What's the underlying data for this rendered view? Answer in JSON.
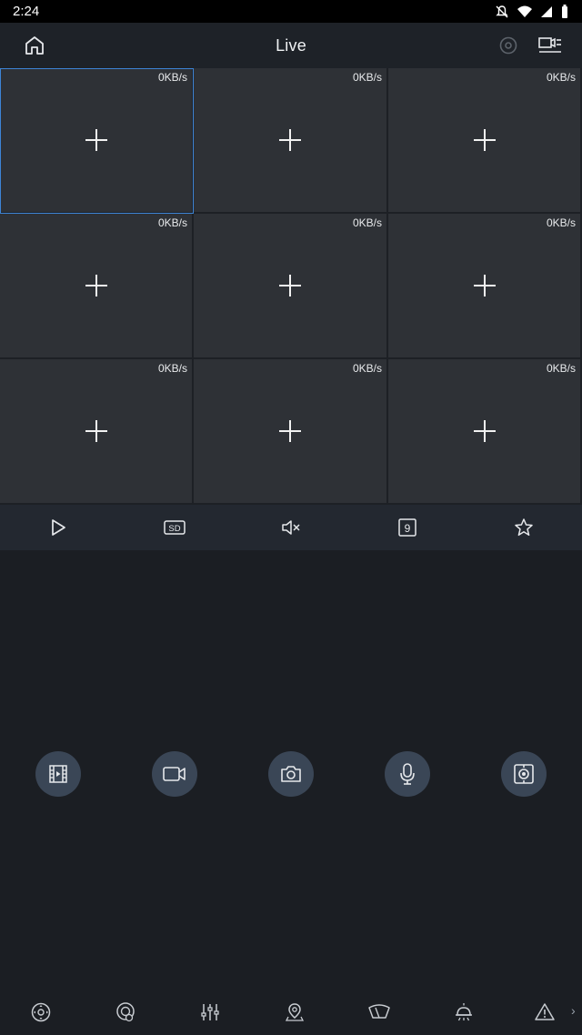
{
  "status_bar": {
    "time": "2:24"
  },
  "header": {
    "title": "Live"
  },
  "grid": {
    "cells": [
      {
        "rate": "0KB/s",
        "selected": true
      },
      {
        "rate": "0KB/s"
      },
      {
        "rate": "0KB/s"
      },
      {
        "rate": "0KB/s"
      },
      {
        "rate": "0KB/s"
      },
      {
        "rate": "0KB/s"
      },
      {
        "rate": "0KB/s"
      },
      {
        "rate": "0KB/s"
      },
      {
        "rate": "0KB/s"
      }
    ]
  },
  "toolbar": {
    "sd_label": "SD",
    "split_label": "9"
  },
  "bottom_bar": {
    "more_label": "›"
  },
  "colors": {
    "background": "#1b1e23",
    "cell": "#2e3136",
    "selected_border": "#3d84d6",
    "action_circle": "#3a4656"
  }
}
